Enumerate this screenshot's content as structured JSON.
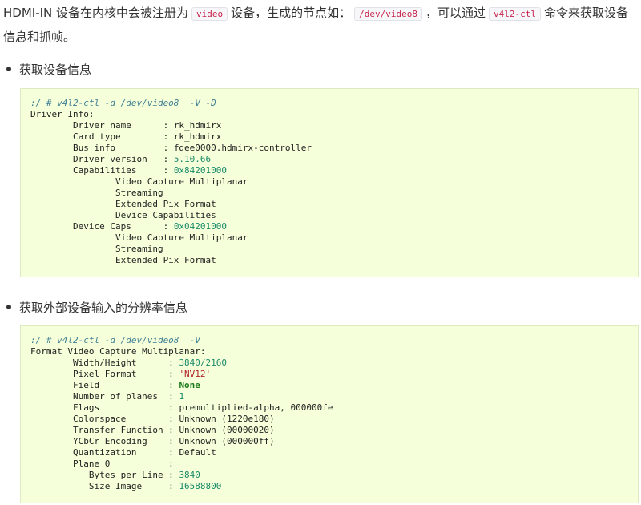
{
  "intro": {
    "part1": "HDMI-IN 设备在内核中会被注册为",
    "code1": "video",
    "part2": "设备，生成的节点如：",
    "code2": "/dev/video8",
    "part3": "，可以通过",
    "code3": "v4l2-ctl",
    "part4": "命令来获取设备信息和抓帧。"
  },
  "section1": {
    "title": "获取设备信息",
    "command": ":/ # v4l2-ctl -d /dev/video8  -V -D",
    "header": "Driver Info:",
    "rows": [
      {
        "key": "Driver name",
        "value": "rk_hdmirx"
      },
      {
        "key": "Card type",
        "value": "rk_hdmirx"
      },
      {
        "key": "Bus info",
        "value": "fdee0000.hdmirx-controller"
      },
      {
        "key": "Driver version",
        "value": "5.10.66"
      },
      {
        "key": "Capabilities",
        "value": "0x84201000"
      }
    ],
    "capabilities": [
      "Video Capture Multiplanar",
      "Streaming",
      "Extended Pix Format",
      "Device Capabilities"
    ],
    "device_caps_key": "Device Caps",
    "device_caps_value": "0x04201000",
    "device_caps": [
      "Video Capture Multiplanar",
      "Streaming",
      "Extended Pix Format"
    ]
  },
  "section2": {
    "title": "获取外部设备输入的分辨率信息",
    "command": ":/ # v4l2-ctl -d /dev/video8  -V",
    "header": "Format Video Capture Multiplanar:",
    "rows": [
      {
        "key": "Width/Height",
        "value": "3840/2160"
      },
      {
        "key": "Pixel Format",
        "value": "'NV12'"
      },
      {
        "key": "Field",
        "value": "None"
      },
      {
        "key": "Number of planes",
        "value": "1"
      },
      {
        "key": "Flags",
        "value": "premultiplied-alpha, 000000fe"
      },
      {
        "key": "Colorspace",
        "value": "Unknown (1220e180)"
      },
      {
        "key": "Transfer Function",
        "value": "Unknown (00000020)"
      },
      {
        "key": "YCbCr Encoding",
        "value": "Unknown (000000ff)"
      },
      {
        "key": "Quantization",
        "value": "Default"
      }
    ],
    "plane_label": "Plane 0",
    "plane_rows": [
      {
        "key": "Bytes per Line",
        "value": "3840"
      },
      {
        "key": "Size Image",
        "value": "16588800"
      }
    ]
  }
}
